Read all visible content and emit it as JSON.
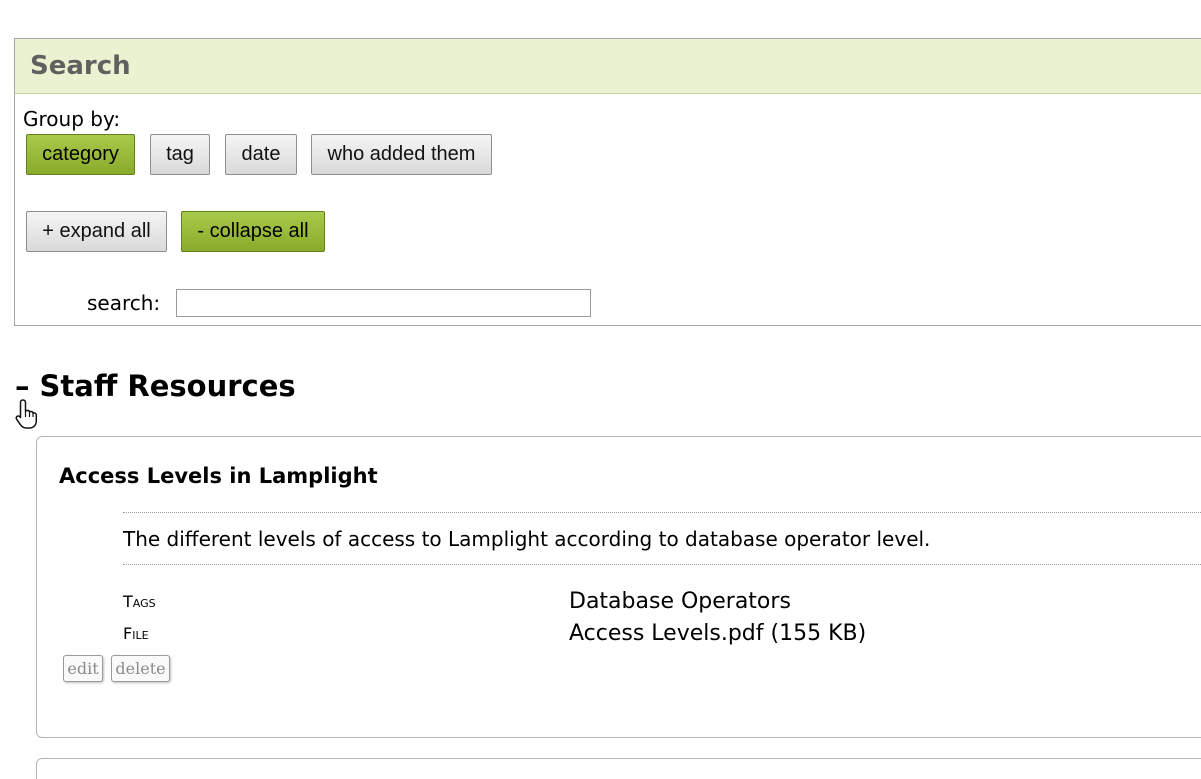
{
  "search": {
    "title": "Search",
    "group_by_label": "Group by:",
    "group_buttons": [
      {
        "label": "category",
        "active": true
      },
      {
        "label": "tag",
        "active": false
      },
      {
        "label": "date",
        "active": false
      },
      {
        "label": "who added them",
        "active": false
      }
    ],
    "expand_label": "+ expand all",
    "collapse_label": "- collapse all",
    "search_label": "search:",
    "search_value": "",
    "search_placeholder": ""
  },
  "section": {
    "toggle": "–",
    "title": "Staff Resources"
  },
  "resource": {
    "title": "Access Levels in Lamplight",
    "description": "The different levels of access to Lamplight according to database operator level.",
    "tags_label": "Tags",
    "tags_value": "Database Operators",
    "file_label": "File",
    "file_value": "Access Levels.pdf (155 KB)",
    "edit_label": "edit",
    "delete_label": "delete"
  },
  "colors": {
    "header_bg": "#ebf2d1",
    "active_button": "#98b93a"
  },
  "icons": {
    "cursor": "hand-pointer-icon"
  }
}
